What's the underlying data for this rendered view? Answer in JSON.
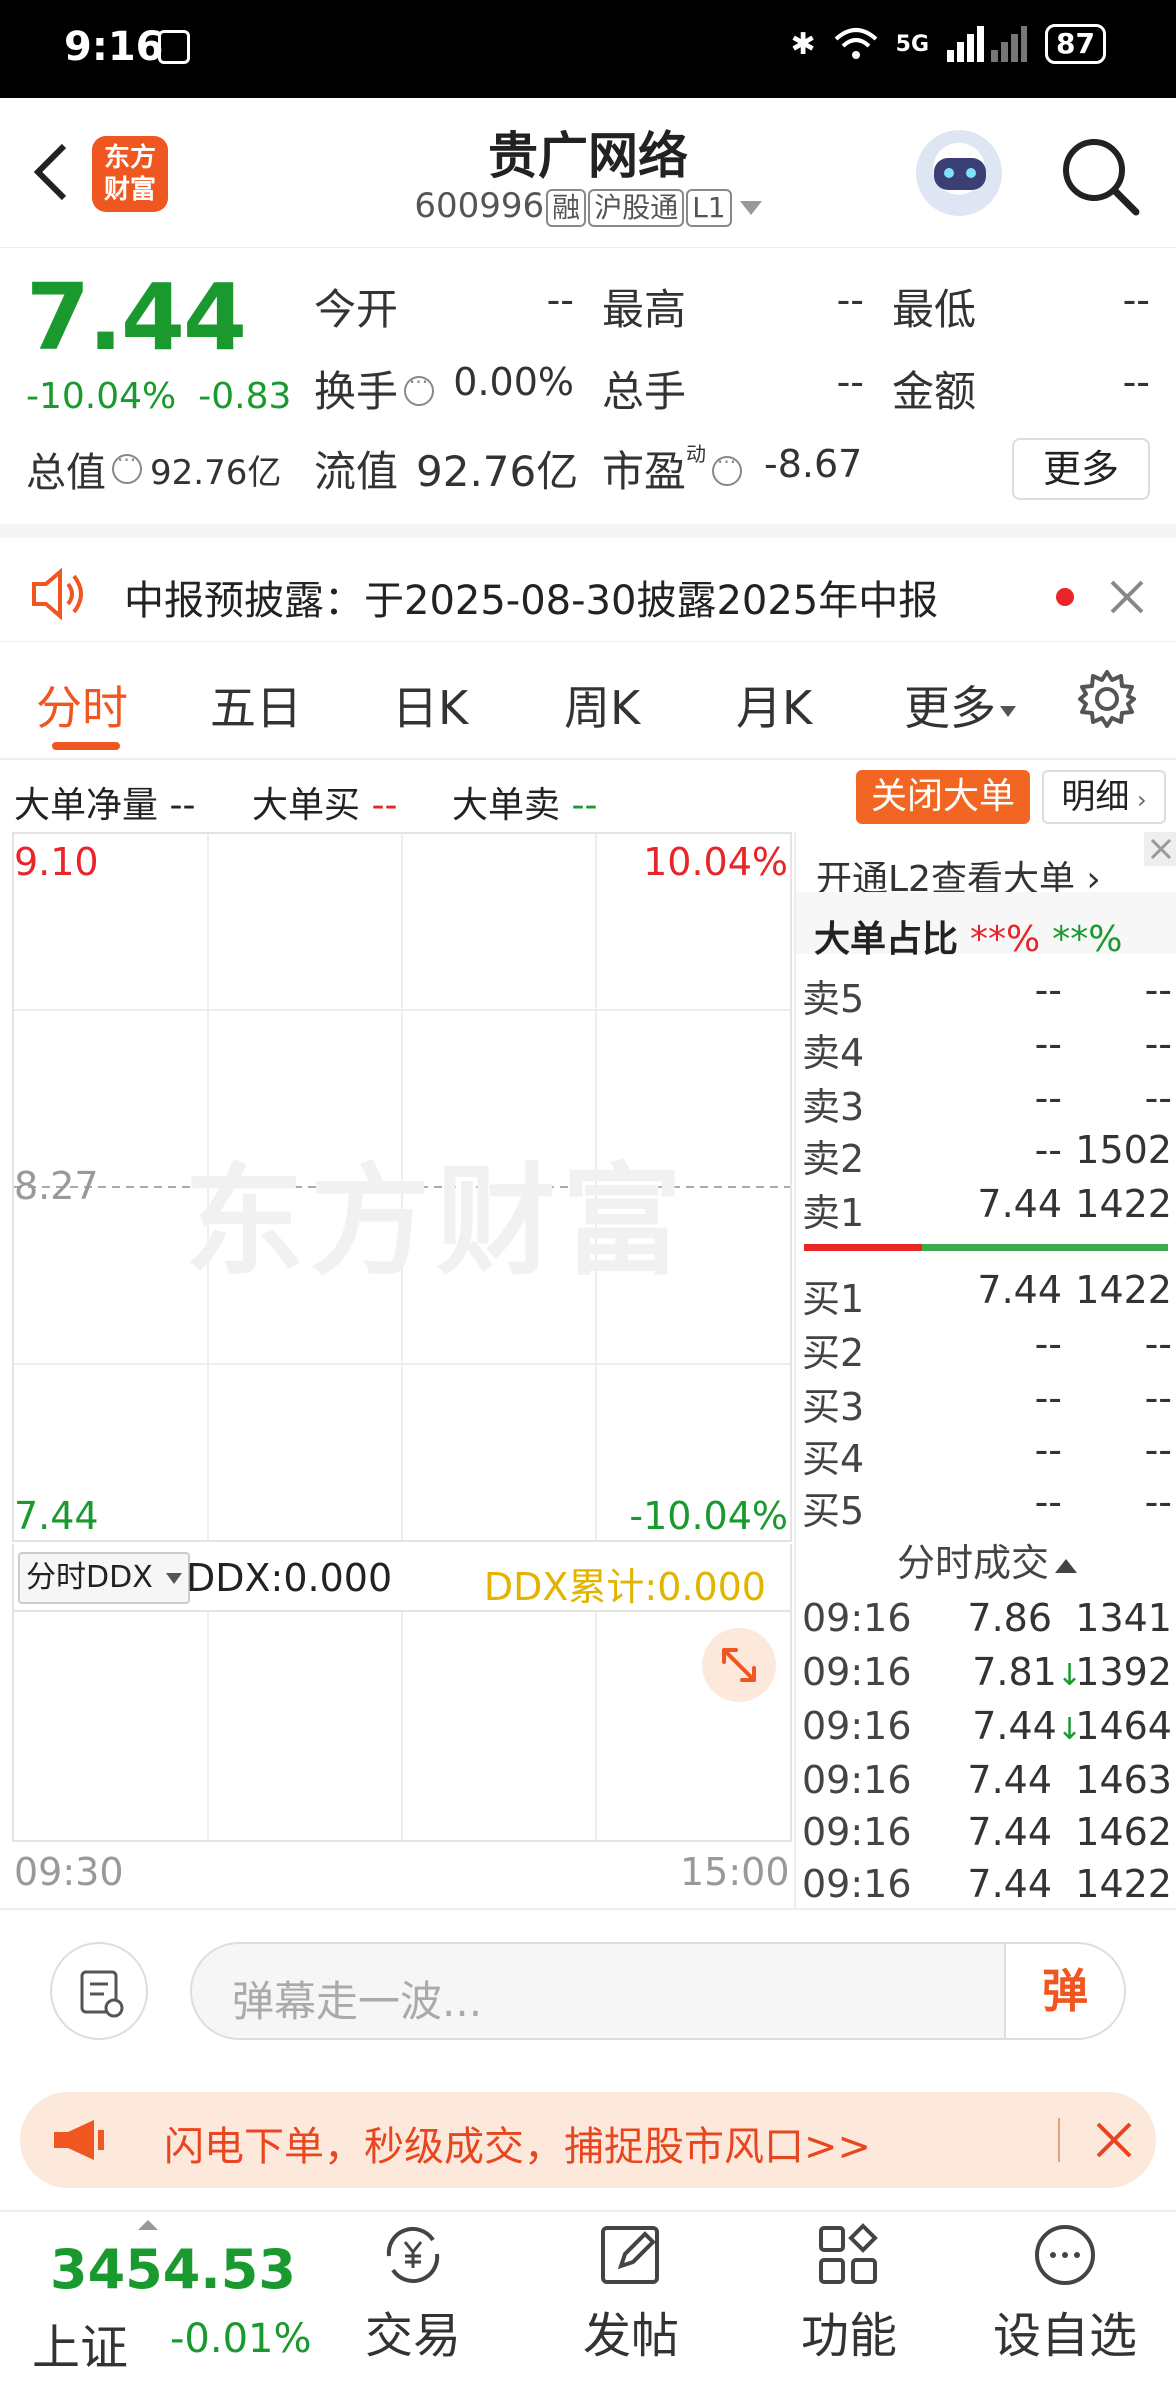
{
  "status_bar": {
    "time": "9:16",
    "battery": "87",
    "net": "5G"
  },
  "header": {
    "logo_text": "东方财富",
    "stock_name": "贵广网络",
    "code": "600996",
    "tags": [
      "融",
      "沪股通",
      "L1"
    ]
  },
  "quote": {
    "price": "7.44",
    "change_pct": "-10.04%",
    "change": "-0.83",
    "total_value_label": "总值",
    "total_value": "92.76亿",
    "open_label": "今开",
    "open": "--",
    "high_label": "最高",
    "high": "--",
    "low_label": "最低",
    "low": "--",
    "turnover_label": "换手",
    "turnover": "0.00%",
    "volume_label": "总手",
    "volume": "--",
    "amount_label": "金额",
    "amount": "--",
    "float_label": "流值",
    "float_value": "92.76亿",
    "pe_label": "市盈",
    "pe_sup": "动",
    "pe": "-8.67",
    "more_label": "更多"
  },
  "notice": {
    "text": "中报预披露：于2025-08-30披露2025年中报"
  },
  "tabs": {
    "t1": "分时",
    "t2": "五日",
    "t3": "日K",
    "t4": "周K",
    "t5": "月K",
    "t6": "更多"
  },
  "big_order": {
    "net_label": "大单净量",
    "net_value": "--",
    "buy_label": "大单买",
    "buy_value": "--",
    "sell_label": "大单卖",
    "sell_value": "--",
    "close_btn": "关闭大单",
    "detail_btn": "明细"
  },
  "chart": {
    "top_price": "9.10",
    "top_pct": "10.04%",
    "mid_price": "8.27",
    "bottom_price": "7.44",
    "bottom_pct": "-10.04%",
    "watermark": "东方财富",
    "ddx_selector": "分时DDX",
    "ddx": "DDX:0.000",
    "ddx_cum": "DDX累计:0.000",
    "time_start": "09:30",
    "time_end": "15:00"
  },
  "order_book": {
    "open_l2": "开通L2查看大单",
    "ratio_label": "大单占比",
    "ratio_buy": "**%",
    "ratio_sell": "**%",
    "asks": [
      {
        "label": "卖5",
        "price": "--",
        "vol": "--"
      },
      {
        "label": "卖4",
        "price": "--",
        "vol": "--"
      },
      {
        "label": "卖3",
        "price": "--",
        "vol": "--"
      },
      {
        "label": "卖2",
        "price": "--",
        "vol": "1502"
      },
      {
        "label": "卖1",
        "price": "7.44",
        "vol": "1422"
      }
    ],
    "bids": [
      {
        "label": "买1",
        "price": "7.44",
        "vol": "1422"
      },
      {
        "label": "买2",
        "price": "--",
        "vol": "--"
      },
      {
        "label": "买3",
        "price": "--",
        "vol": "--"
      },
      {
        "label": "买4",
        "price": "--",
        "vol": "--"
      },
      {
        "label": "买5",
        "price": "--",
        "vol": "--"
      }
    ],
    "trades_title": "分时成交",
    "trades": [
      {
        "time": "09:16",
        "price": "7.86",
        "arrow": "",
        "vol": "1341"
      },
      {
        "time": "09:16",
        "price": "7.81",
        "arrow": "↓",
        "vol": "1392"
      },
      {
        "time": "09:16",
        "price": "7.44",
        "arrow": "↓",
        "vol": "1464"
      },
      {
        "time": "09:16",
        "price": "7.44",
        "arrow": "",
        "vol": "1463"
      },
      {
        "time": "09:16",
        "price": "7.44",
        "arrow": "",
        "vol": "1462"
      },
      {
        "time": "09:16",
        "price": "7.44",
        "arrow": "",
        "vol": "1422"
      }
    ]
  },
  "danmu": {
    "placeholder": "弹幕走一波...",
    "send": "弹"
  },
  "promo": {
    "text": "闪电下单，秒级成交，捕捉股市风口>>"
  },
  "bottom_nav": {
    "index_value": "3454.53",
    "index_name": "上证",
    "index_change": "-0.01%",
    "trade": "交易",
    "post": "发帖",
    "functions": "功能",
    "watchlist": "设自选"
  },
  "colors": {
    "brand": "#f0561f",
    "down": "#1a9a2e",
    "up": "#e8262a",
    "ddx": "#e2b400"
  }
}
